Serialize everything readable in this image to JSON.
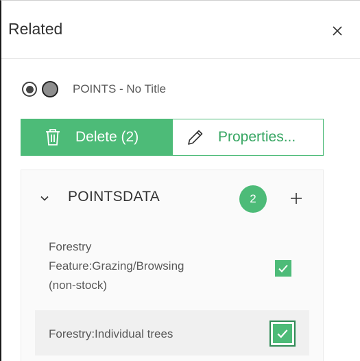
{
  "panel": {
    "title": "Related",
    "close_icon": "close-icon"
  },
  "layer": {
    "label": "POINTS - No Title",
    "radio_selected": true,
    "swatch_color": "#8e8e8e"
  },
  "actions": {
    "delete_label": "Delete (2)",
    "properties_label": "Properties...",
    "accent_color": "#4dbb78"
  },
  "group": {
    "title": "POINTSDATA",
    "count": "2",
    "add_icon": "plus-icon",
    "chevron_icon": "chevron-down-icon"
  },
  "items": [
    {
      "label_lines": [
        "Forestry",
        "Feature:Grazing/Browsing",
        "(non-stock)"
      ],
      "checked": true,
      "focused": false
    },
    {
      "label_lines": [
        "Forestry:Individual trees"
      ],
      "checked": true,
      "focused": true
    }
  ]
}
